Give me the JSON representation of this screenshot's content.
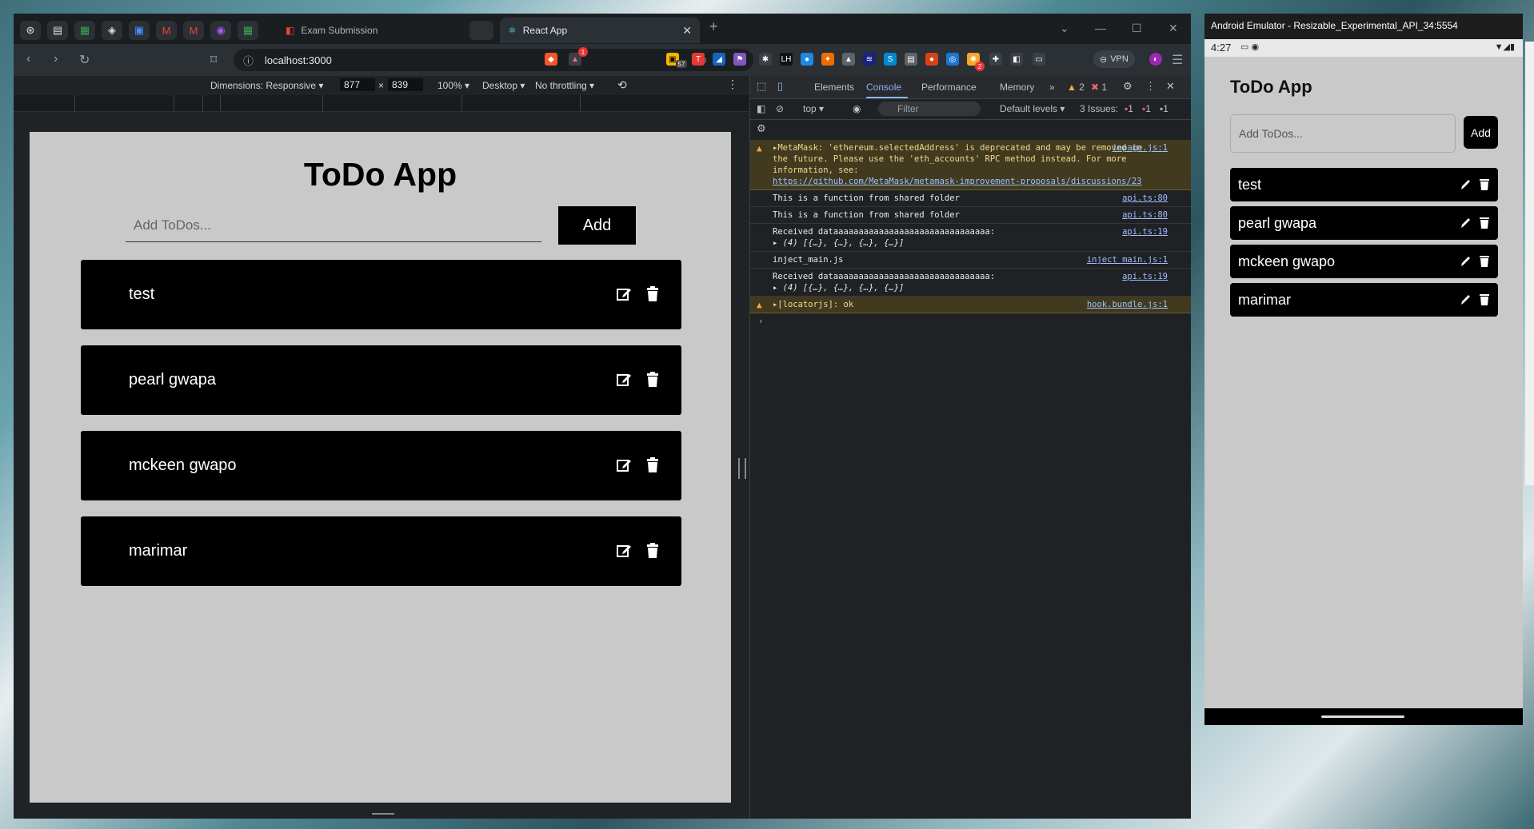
{
  "browser": {
    "tabs": [
      {
        "label": "Exam Submission"
      },
      {
        "label": "React App"
      }
    ],
    "url": "localhost:3000",
    "extension_badges": {
      "shield_count": "57",
      "alert_count": "1",
      "extra_count": "2"
    },
    "vpn_label": "VPN"
  },
  "device_toolbar": {
    "dimensions_label": "Dimensions: Responsive",
    "width": "877",
    "times": "×",
    "height": "839",
    "zoom": "100%",
    "device": "Desktop",
    "throttling": "No throttling"
  },
  "app": {
    "title": "ToDo App",
    "input_placeholder": "Add ToDos...",
    "add_label": "Add",
    "todos": [
      "test",
      "pearl gwapa",
      "mckeen gwapo",
      "marimar"
    ]
  },
  "devtools": {
    "tabs": [
      "Elements",
      "Console",
      "Performance",
      "Memory"
    ],
    "more": "»",
    "warn_count": "2",
    "error_count": "1",
    "context": "top",
    "filter_placeholder": "Filter",
    "levels": "Default levels",
    "issues_label": "3 Issues:",
    "issues_counts": [
      "1",
      "1",
      "1"
    ],
    "messages": [
      {
        "text": "▸MetaMask: 'ethereum.selectedAddress' is deprecated and may be removed in the future. Please use the 'eth_accounts' RPC method instead. For more information, see:",
        "link": "https://github.com/MetaMask/metamask-improvement-proposals/discussions/23",
        "source": "inpage.js:1",
        "level": "warn"
      },
      {
        "text": "This is a function from shared folder",
        "source": "api.ts:80",
        "level": "log"
      },
      {
        "text": "This is a function from shared folder",
        "source": "api.ts:80",
        "level": "log"
      },
      {
        "text": "Received dataaaaaaaaaaaaaaaaaaaaaaaaaaaaaaa:",
        "sub": "▸ (4) [{…}, {…}, {…}, {…}]",
        "source": "api.ts:19",
        "level": "log"
      },
      {
        "text": "inject_main.js",
        "source": "inject main.js:1",
        "level": "log"
      },
      {
        "text": "Received dataaaaaaaaaaaaaaaaaaaaaaaaaaaaaaa:",
        "sub": "▸ (4) [{…}, {…}, {…}, {…}]",
        "source": "api.ts:19",
        "level": "log"
      },
      {
        "text": "▸[locatorjs]: ok",
        "source": "hook.bundle.js:1",
        "level": "warn"
      }
    ],
    "prompt": "›"
  },
  "emulator": {
    "title": "Android Emulator - Resizable_Experimental_API_34:5554",
    "time": "4:27",
    "app_title": "ToDo App",
    "input_placeholder": "Add ToDos...",
    "add_label": "Add",
    "todos": [
      "test",
      "pearl gwapa",
      "mckeen gwapo",
      "marimar"
    ]
  },
  "colors": {
    "item_bg": "#000000",
    "viewport_bg": "#c9c9c9",
    "devtools_bg": "#202124",
    "link": "#9cc0ff"
  }
}
